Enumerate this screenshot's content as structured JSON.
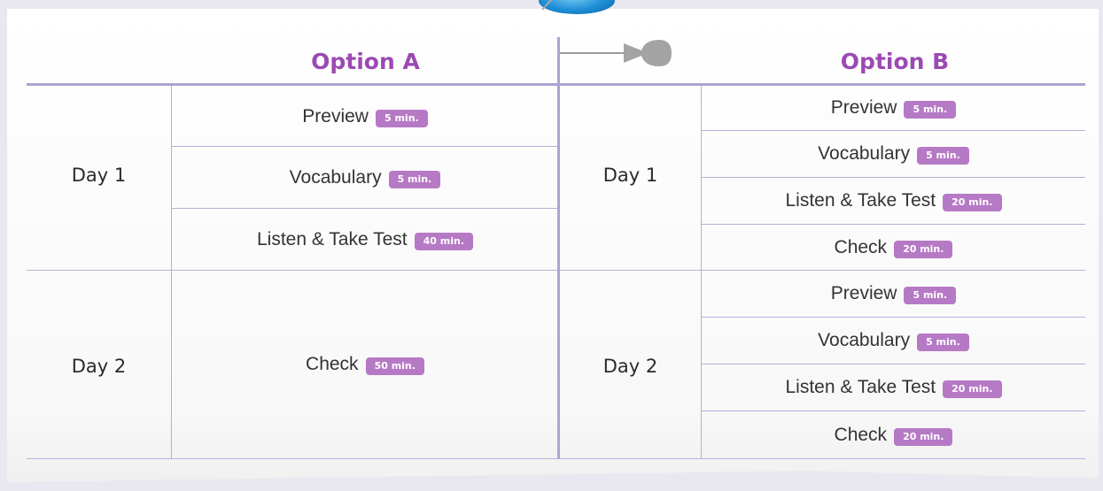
{
  "headers": {
    "option_a": "Option A",
    "option_b": "Option B"
  },
  "option_a": {
    "days": [
      {
        "label": "Day 1",
        "tasks": [
          {
            "name": "Preview",
            "time": "5 min."
          },
          {
            "name": "Vocabulary",
            "time": "5 min."
          },
          {
            "name": "Listen & Take Test",
            "time": "40 min."
          }
        ]
      },
      {
        "label": "Day 2",
        "tasks": [
          {
            "name": "Check",
            "time": "50 min."
          }
        ]
      }
    ]
  },
  "option_b": {
    "days": [
      {
        "label": "Day 1",
        "tasks": [
          {
            "name": "Preview",
            "time": "5 min."
          },
          {
            "name": "Vocabulary",
            "time": "5 min."
          },
          {
            "name": "Listen & Take Test",
            "time": "20 min."
          },
          {
            "name": "Check",
            "time": "20 min."
          }
        ]
      },
      {
        "label": "Day 2",
        "tasks": [
          {
            "name": "Preview",
            "time": "5 min."
          },
          {
            "name": "Vocabulary",
            "time": "5 min."
          },
          {
            "name": "Listen & Take Test",
            "time": "20 min."
          },
          {
            "name": "Check",
            "time": "20 min."
          }
        ]
      }
    ]
  },
  "colors": {
    "accent": "#9b4ab2",
    "badge": "#b679c5",
    "rule": "#b3b1d6"
  },
  "icons": {
    "pin": "pushpin-icon"
  }
}
